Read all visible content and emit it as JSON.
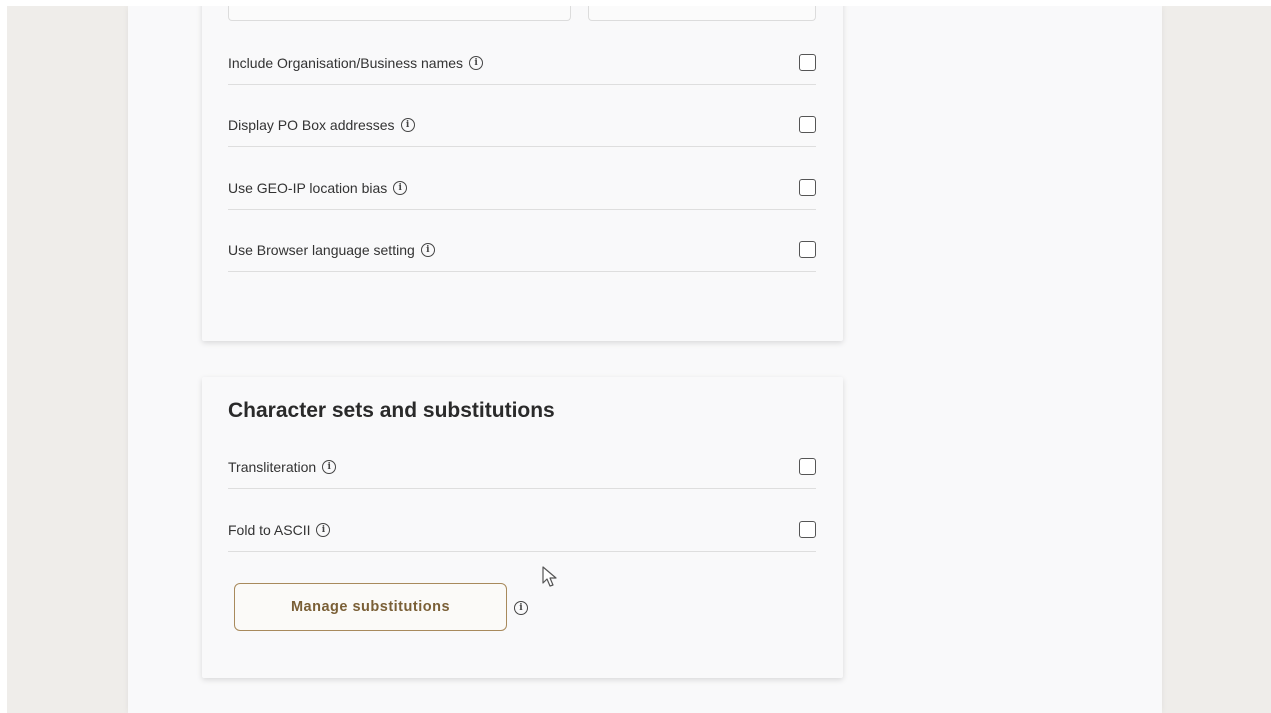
{
  "lookup_options": {
    "rows": [
      {
        "label": "Include Organisation/Business names",
        "checked": false
      },
      {
        "label": "Display PO Box addresses",
        "checked": false
      },
      {
        "label": "Use GEO-IP location bias",
        "checked": false
      },
      {
        "label": "Use Browser language setting",
        "checked": false
      }
    ]
  },
  "charsets": {
    "title": "Character sets and substitutions",
    "rows": [
      {
        "label": "Transliteration",
        "checked": false
      },
      {
        "label": "Fold to ASCII",
        "checked": false
      }
    ],
    "manage_button_label": "Manage substitutions"
  },
  "icons": {
    "info": "info-circle-icon",
    "checkbox": "checkbox-unchecked",
    "cursor": "mouse-pointer-icon"
  },
  "colors": {
    "button_border": "#a88a5c",
    "button_text": "#7a5f36",
    "background": "#efedea",
    "card": "#f9f9fa"
  }
}
